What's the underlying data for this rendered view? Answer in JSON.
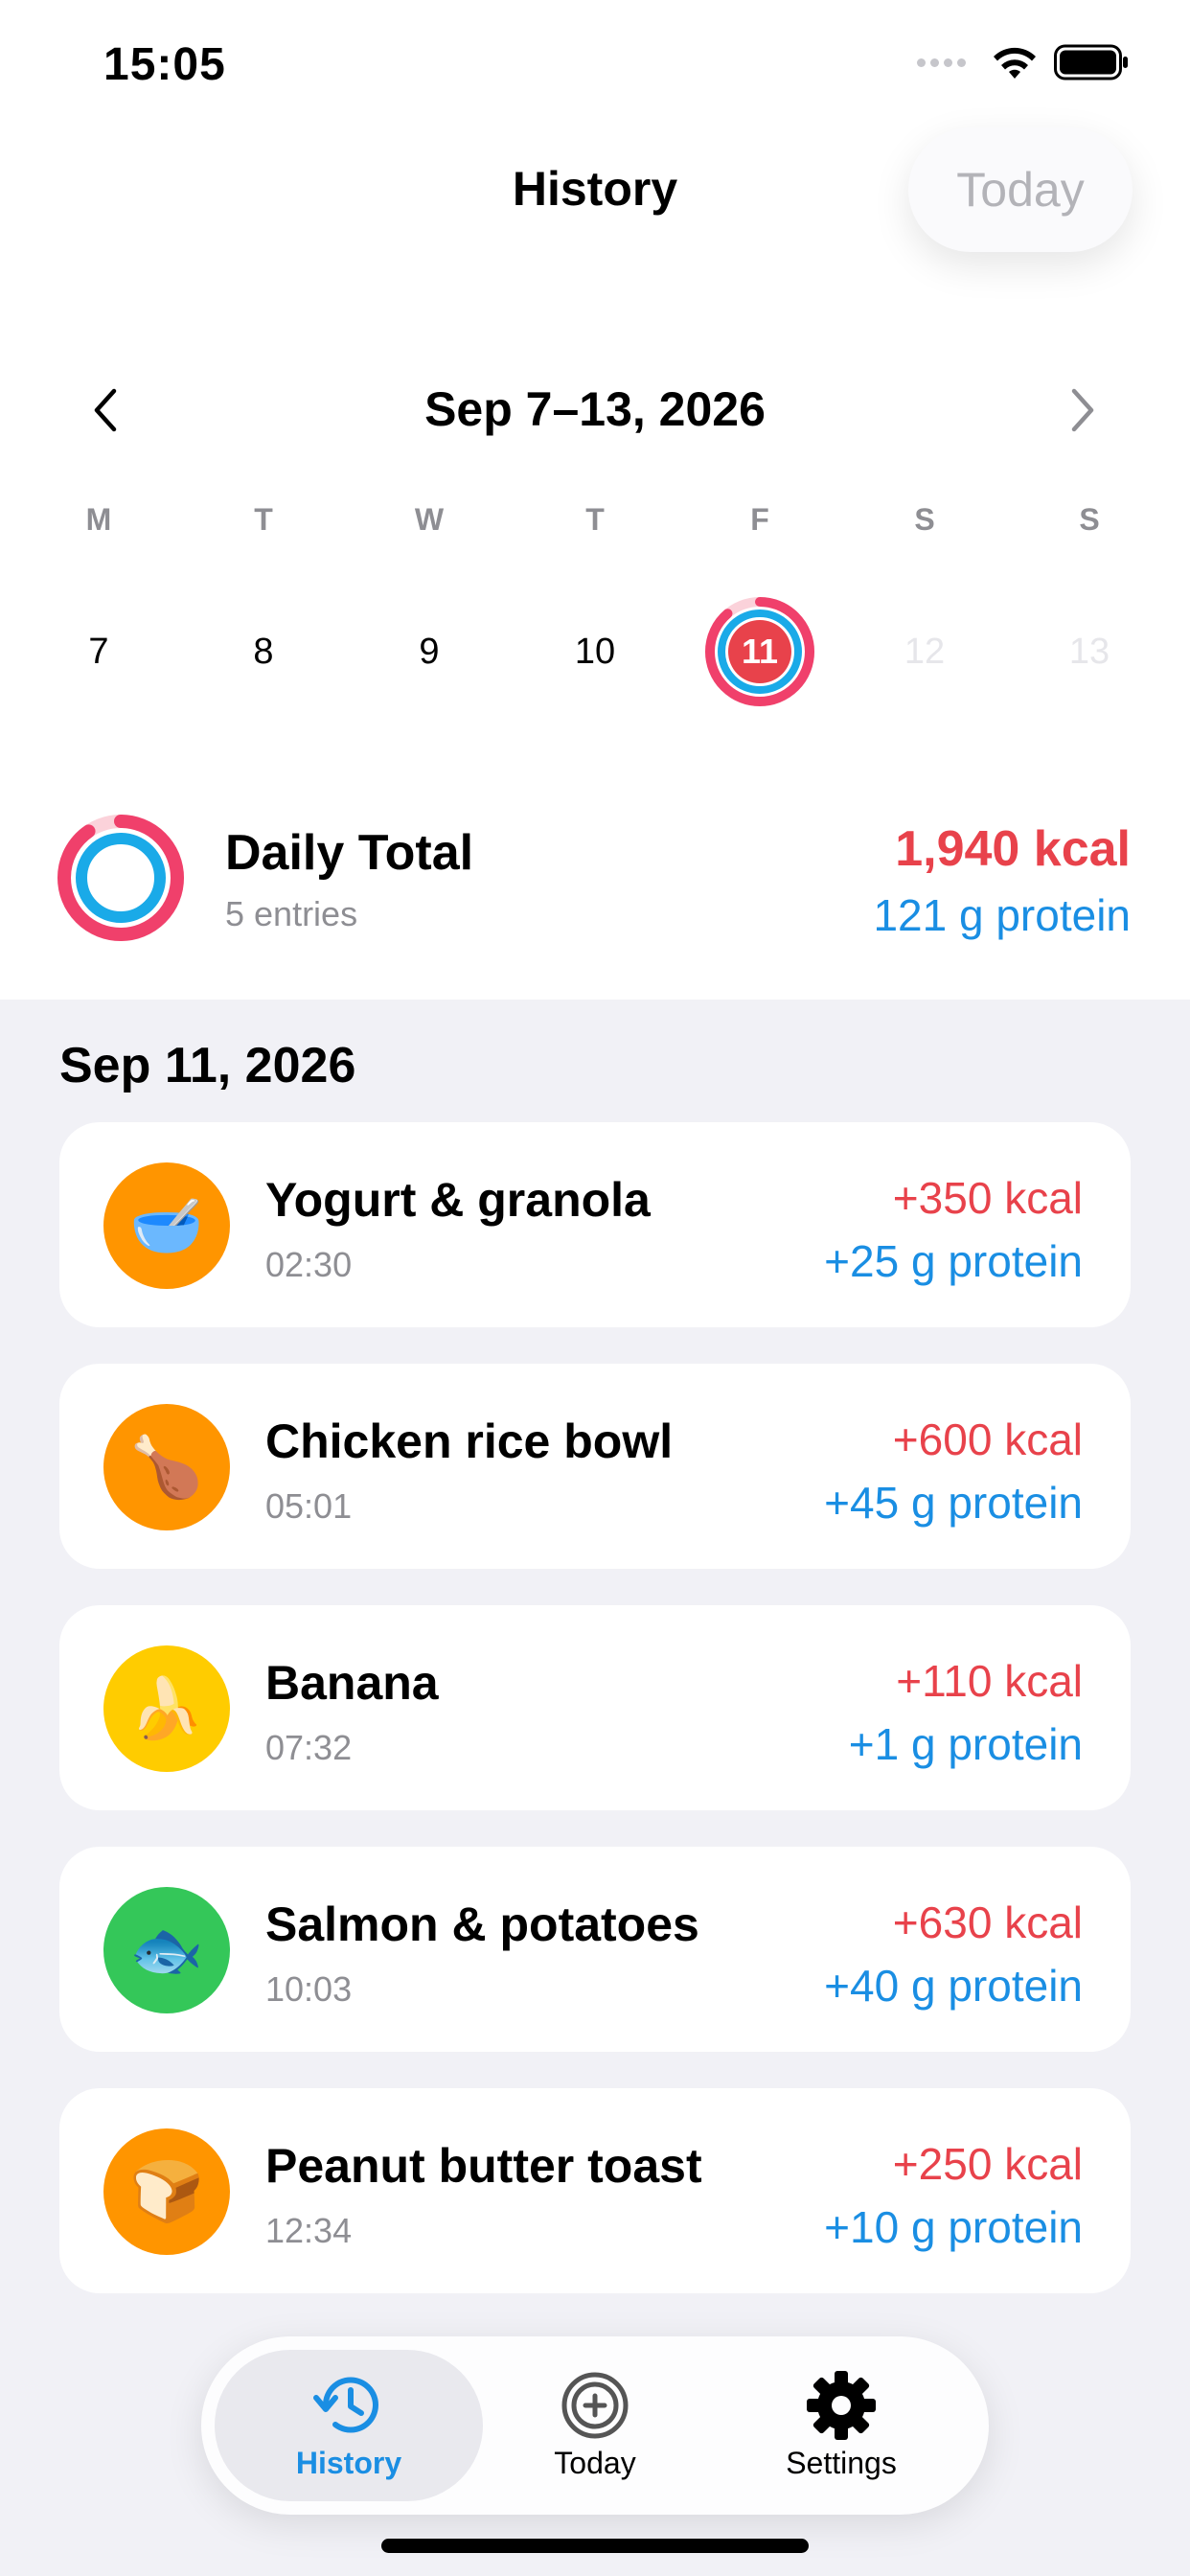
{
  "status": {
    "time": "15:05"
  },
  "nav": {
    "title": "History",
    "today_label": "Today"
  },
  "week": {
    "range_label": "Sep 7–13, 2026",
    "weekdays": [
      "M",
      "T",
      "W",
      "T",
      "F",
      "S",
      "S"
    ],
    "dates": [
      "7",
      "8",
      "9",
      "10",
      "11",
      "12",
      "13"
    ],
    "selected_index": 4
  },
  "daily_total": {
    "title": "Daily Total",
    "subtitle": "5 entries",
    "kcal": "1,940 kcal",
    "protein": "121 g protein"
  },
  "day": {
    "heading": "Sep 11, 2026"
  },
  "entries": [
    {
      "name": "Yogurt & granola",
      "time": "02:30",
      "kcal": "+350 kcal",
      "protein": "+25 g protein",
      "icon": "bowl-icon",
      "emoji": "🥣",
      "color": "#ff9500"
    },
    {
      "name": "Chicken rice bowl",
      "time": "05:01",
      "kcal": "+600 kcal",
      "protein": "+45 g protein",
      "icon": "drumstick-icon",
      "emoji": "🍗",
      "color": "#ff9500"
    },
    {
      "name": "Banana",
      "time": "07:32",
      "kcal": "+110 kcal",
      "protein": "+1 g protein",
      "icon": "banana-icon",
      "emoji": "🍌",
      "color": "#ffcc00"
    },
    {
      "name": "Salmon & potatoes",
      "time": "10:03",
      "kcal": "+630 kcal",
      "protein": "+40 g protein",
      "icon": "fish-icon",
      "emoji": "🐟",
      "color": "#34c759"
    },
    {
      "name": "Peanut butter toast",
      "time": "12:34",
      "kcal": "+250 kcal",
      "protein": "+10 g protein",
      "icon": "bread-icon",
      "emoji": "🍞",
      "color": "#ff9500"
    }
  ],
  "tabs": [
    {
      "label": "History",
      "icon": "history-clock-icon",
      "active": true
    },
    {
      "label": "Today",
      "icon": "target-plus-icon",
      "active": false
    },
    {
      "label": "Settings",
      "icon": "gear-icon",
      "active": false
    }
  ],
  "colors": {
    "kcal": "#e8424b",
    "protein": "#1a8ee3",
    "ring_outer": "#f0406b",
    "ring_inner": "#1aaae8",
    "accent": "#1a8ee3"
  }
}
